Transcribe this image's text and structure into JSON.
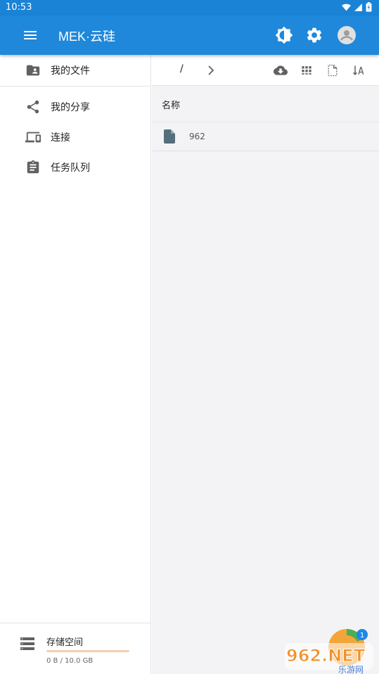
{
  "status_bar": {
    "time": "10:53"
  },
  "app_bar": {
    "title": "MEK·云硅"
  },
  "sidebar": {
    "items": [
      {
        "label": "我的文件",
        "icon": "folder-account-icon"
      },
      {
        "label": "我的分享",
        "icon": "share-icon"
      },
      {
        "label": "连接",
        "icon": "devices-icon"
      },
      {
        "label": "任务队列",
        "icon": "clipboard-icon"
      }
    ],
    "storage": {
      "label": "存储空间",
      "usage": "0 B / 10.0 GB",
      "used_fraction": 0
    }
  },
  "toolbar": {
    "path": "/"
  },
  "file_list": {
    "column_name": "名称",
    "rows": [
      {
        "name": "962",
        "type": "file"
      }
    ]
  },
  "watermark": {
    "text": "962.NET",
    "subtext": "乐游网",
    "badge": "1"
  },
  "colors": {
    "primary": "#1f88da",
    "status": "#1a83d6",
    "icon_gray": "#616161",
    "accent": "#f08a3a"
  }
}
